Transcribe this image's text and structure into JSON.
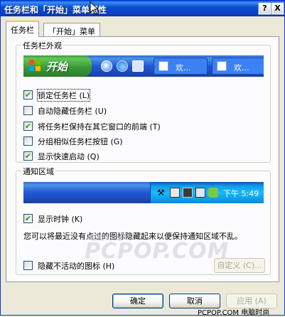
{
  "window": {
    "title": "任务栏和「开始」菜单属性",
    "help_label": "?",
    "close_label": "X"
  },
  "tabs": [
    {
      "label": "任务栏",
      "active": true
    },
    {
      "label": "「开始」菜单",
      "active": false
    }
  ],
  "appearance": {
    "group_label": "任务栏外观",
    "start_label": "开始",
    "task_buttons": [
      "欢...",
      "欢..."
    ],
    "options": [
      {
        "label": "锁定任务栏 (L)",
        "checked": true
      },
      {
        "label": "自动隐藏任务栏 (U)",
        "checked": false
      },
      {
        "label": "将任务栏保持在其它窗口的前端 (T)",
        "checked": true
      },
      {
        "label": "分组相似任务栏按钮 (G)",
        "checked": false
      },
      {
        "label": "显示快速启动 (Q)",
        "checked": true
      }
    ]
  },
  "notification": {
    "group_label": "通知区域",
    "clock_text": "下午 5:49",
    "show_clock": {
      "label": "显示时钟 (K)",
      "checked": true
    },
    "description": "您可以将最近没有点过的图标隐藏起来以便保持通知区域不乱。",
    "hide_inactive": {
      "label": "隐藏不活动的图标 (H)",
      "checked": false
    },
    "customize_label": "自定义 (C)..."
  },
  "buttons": {
    "ok": "确定",
    "cancel": "取消",
    "apply": "应用 (A)"
  },
  "watermarks": {
    "small": "电脑时尚",
    "large": "PCPOP.COM",
    "footer": "PCPOP.COM 电脑时尚"
  },
  "colors": {
    "titlebar": "#0a4fd0",
    "taskbar": "#2157d7",
    "start_button": "#3a9a37",
    "tray": "#18b9ff",
    "checkmark": "#21a121"
  }
}
